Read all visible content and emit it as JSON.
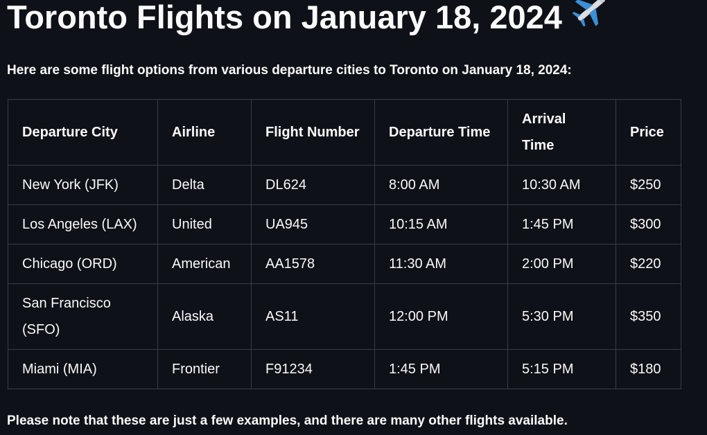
{
  "page": {
    "title": "Toronto Flights on January 18, 2024",
    "title_icon": "airplane-icon",
    "intro": "Here are some flight options from various departure cities to Toronto on January 18, 2024:",
    "note": "Please note that these are just a few examples, and there are many other flights available."
  },
  "table": {
    "headers": [
      "Departure City",
      "Airline",
      "Flight Number",
      "Departure Time",
      "Arrival Time",
      "Price"
    ],
    "rows": [
      [
        "New York (JFK)",
        "Delta",
        "DL624",
        "8:00 AM",
        "10:30 AM",
        "$250"
      ],
      [
        "Los Angeles (LAX)",
        "United",
        "UA945",
        "10:15 AM",
        "1:45 PM",
        "$300"
      ],
      [
        "Chicago (ORD)",
        "American",
        "AA1578",
        "11:30 AM",
        "2:00 PM",
        "$220"
      ],
      [
        "San Francisco (SFO)",
        "Alaska",
        "AS11",
        "12:00 PM",
        "5:30 PM",
        "$350"
      ],
      [
        "Miami (MIA)",
        "Frontier",
        "F91234",
        "1:45 PM",
        "5:15 PM",
        "$180"
      ]
    ]
  },
  "colors": {
    "background": "#0e1117",
    "text": "#fafafa",
    "border": "#3a3d45",
    "plane_blue": "#3b8fd6",
    "plane_body": "#d9dde3"
  }
}
